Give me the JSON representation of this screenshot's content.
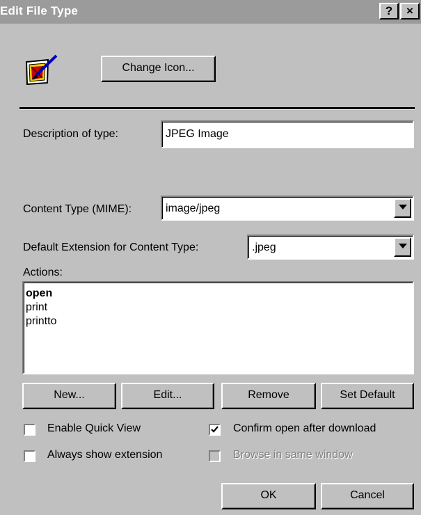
{
  "window": {
    "title": "Edit File Type",
    "help_button": "?",
    "close_button": "×"
  },
  "icon_section": {
    "icon": "jpeg-image-file-icon",
    "change_icon_button": "Change Icon..."
  },
  "description": {
    "label": "Description of type:",
    "value": "JPEG Image"
  },
  "content_type": {
    "label": "Content Type (MIME):",
    "value": "image/jpeg"
  },
  "default_extension": {
    "label": "Default Extension for Content Type:",
    "value": ".jpeg"
  },
  "actions": {
    "label": "Actions:",
    "items": [
      "open",
      "print",
      "printto"
    ],
    "default_item": "open"
  },
  "action_buttons": {
    "new": "New...",
    "edit": "Edit...",
    "remove": "Remove",
    "set_default": "Set Default"
  },
  "options": {
    "enable_quick_view": {
      "label": "Enable Quick View",
      "checked": false
    },
    "confirm_open": {
      "label": "Confirm open after download",
      "checked": true
    },
    "always_show_extension": {
      "label": "Always show extension",
      "checked": false
    },
    "browse_same_window": {
      "label": "Browse in same window",
      "checked": false,
      "disabled": true
    }
  },
  "dialog_buttons": {
    "ok": "OK",
    "cancel": "Cancel"
  },
  "colors": {
    "dialog_background": "#c0c0c0",
    "titlebar_inactive": "#9b9b9b",
    "field_background": "#ffffff",
    "disabled_text": "#808080"
  }
}
